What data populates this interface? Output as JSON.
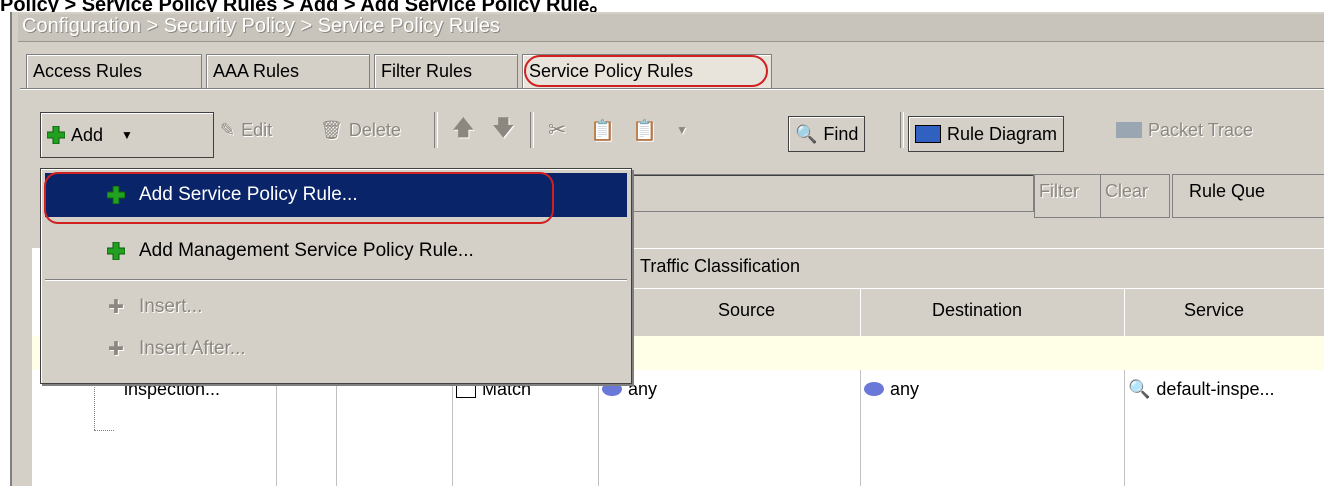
{
  "caption": "Policy > Service Policy Rules > Add > Add Service Policy Rule。",
  "breadcrumb": "Configuration > Security Policy > Service Policy Rules",
  "tabs": [
    {
      "label": "Access Rules"
    },
    {
      "label": "AAA Rules"
    },
    {
      "label": "Filter Rules"
    },
    {
      "label": "Service Policy Rules",
      "active": true
    }
  ],
  "toolbar": {
    "add": "Add",
    "edit": "Edit",
    "delete": "Delete",
    "find": "Find",
    "rule_diagram": "Rule Diagram",
    "packet_trace": "Packet Trace"
  },
  "filter": {
    "filter_label": "Filter",
    "clear_label": "Clear",
    "rule_query_label": "Rule Que"
  },
  "add_menu": {
    "items": [
      {
        "label": "Add Service Policy Rule...",
        "selected": true
      },
      {
        "label": "Add Management Service Policy Rule..."
      },
      {
        "label": "Insert...",
        "disabled": true
      },
      {
        "label": "Insert After...",
        "disabled": true
      }
    ]
  },
  "table": {
    "group_header": "Traffic Classification",
    "columns": [
      "Source",
      "Destination",
      "Service"
    ],
    "row": {
      "name": "inspection...",
      "match": "Match",
      "source": "any",
      "destination": "any",
      "service": "default-inspe..."
    }
  },
  "colors": {
    "highlight": "#d02020",
    "menu_selected": "#0a246a",
    "plus_green": "#22a022"
  }
}
